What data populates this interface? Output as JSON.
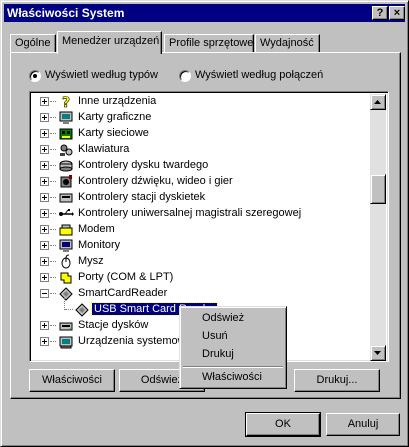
{
  "window": {
    "title": "Właściwości System",
    "help_glyph": "?",
    "close_glyph": "×"
  },
  "tabs": [
    {
      "label": "Ogólne"
    },
    {
      "label": "Menedżer urządzeń"
    },
    {
      "label": "Profile sprzętowe"
    },
    {
      "label": "Wydajność"
    }
  ],
  "view_options": {
    "by_type": "Wyświetl według typów",
    "by_connection": "Wyświetl według połączeń",
    "selected": "by_type"
  },
  "device_tree": [
    {
      "label": "Inne urządzenia",
      "icon": "question-icon"
    },
    {
      "label": "Karty graficzne",
      "icon": "display-adapter-icon"
    },
    {
      "label": "Karty sieciowe",
      "icon": "network-card-icon"
    },
    {
      "label": "Klawiatura",
      "icon": "keyboard-icon"
    },
    {
      "label": "Kontrolery dysku twardego",
      "icon": "disk-controller-icon"
    },
    {
      "label": "Kontrolery dźwięku, wideo i gier",
      "icon": "sound-icon"
    },
    {
      "label": "Kontrolery stacji dyskietek",
      "icon": "floppy-controller-icon"
    },
    {
      "label": "Kontrolery uniwersalnej magistrali szeregowej",
      "icon": "usb-icon"
    },
    {
      "label": "Modem",
      "icon": "modem-icon"
    },
    {
      "label": "Monitory",
      "icon": "monitor-icon"
    },
    {
      "label": "Mysz",
      "icon": "mouse-icon"
    },
    {
      "label": "Porty (COM & LPT)",
      "icon": "port-icon"
    },
    {
      "label": "SmartCardReader",
      "icon": "smartcard-icon",
      "expanded": true
    },
    {
      "label": "USB Smart Card Reader",
      "icon": "smartcard-icon",
      "child": true,
      "selected": true
    },
    {
      "label": "Stacje dysków",
      "icon": "disk-drive-icon"
    },
    {
      "label": "Urządzenia systemowe",
      "icon": "system-device-icon"
    }
  ],
  "buttons": {
    "properties": "Właściwości",
    "refresh": "Odśwież",
    "print": "Drukuj...",
    "ok": "OK",
    "cancel": "Anuluj"
  },
  "context_menu": {
    "refresh": "Odśwież",
    "remove": "Usuń",
    "print": "Drukuj",
    "properties": "Właściwości"
  }
}
